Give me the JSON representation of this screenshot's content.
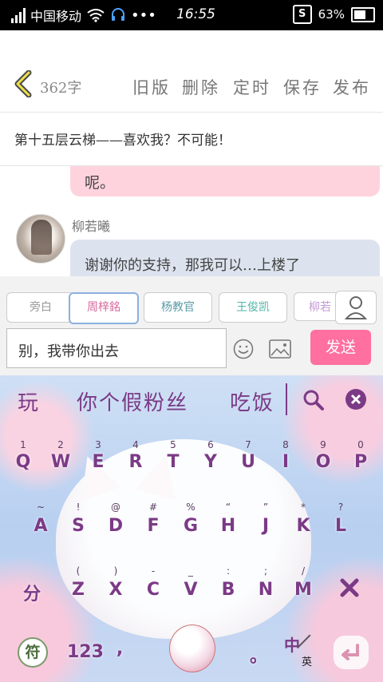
{
  "status": {
    "carrier": "中国移动",
    "time": "16:55",
    "battery": "63%",
    "s_icon": "S"
  },
  "toolbar": {
    "word_count": "362字",
    "old": "旧版",
    "delete": "删除",
    "timer": "定时",
    "save": "保存",
    "publish": "发布"
  },
  "title": "第十五层云梯——喜欢我？不可能！",
  "chat": {
    "prev_tail": "呢。",
    "speaker": "柳若曦",
    "message": "谢谢你的支持，那我可以…上楼了"
  },
  "chips": [
    "旁白",
    "周梓銘",
    "杨教官",
    "王俊凯",
    "柳若"
  ],
  "input": {
    "value": "别，我带你出去",
    "send": "发送"
  },
  "keyboard": {
    "candidates": [
      "玩",
      "你个假粉丝",
      "吃饭"
    ],
    "row1": [
      "Q",
      "W",
      "E",
      "R",
      "T",
      "Y",
      "U",
      "I",
      "O",
      "P"
    ],
    "row1_hints": [
      "1",
      "2",
      "3",
      "4",
      "5",
      "6",
      "7",
      "8",
      "9",
      "0"
    ],
    "row2": [
      "A",
      "S",
      "D",
      "F",
      "G",
      "H",
      "J",
      "K",
      "L"
    ],
    "row2_hints": [
      "~",
      "!",
      "@",
      "#",
      "%",
      "“",
      "”",
      "*",
      "?"
    ],
    "row3": [
      "Z",
      "X",
      "C",
      "V",
      "B",
      "N",
      "M"
    ],
    "row3_hints": [
      "(",
      ")",
      "-",
      "_",
      ":",
      ";",
      "/"
    ],
    "fen": "分",
    "fu": "符",
    "num": "123",
    "comma": ",",
    "period": "。",
    "zh": "中",
    "en": "英"
  }
}
